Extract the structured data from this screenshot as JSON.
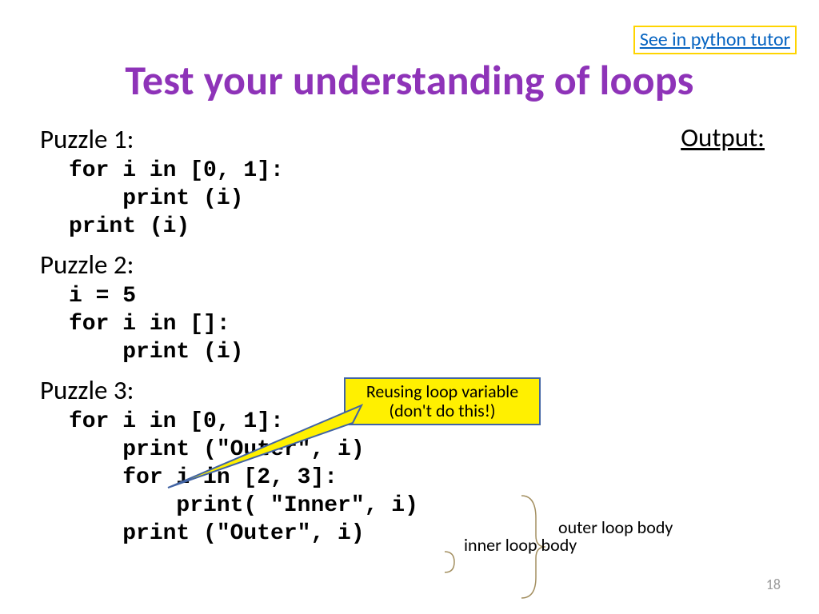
{
  "link": {
    "label": "See in python tutor"
  },
  "title": "Test your understanding of loops",
  "output_label": "Output:",
  "puzzles": {
    "p1": {
      "heading": "Puzzle 1:",
      "code": "for i in [0, 1]:\n    print (i)\nprint (i)"
    },
    "p2": {
      "heading": "Puzzle 2:",
      "code": "i = 5\nfor i in []:\n    print (i)"
    },
    "p3": {
      "heading": "Puzzle 3:",
      "code": "for i in [0, 1]:\n    print (\"Outer\", i)\n    for i in [2, 3]:\n        print( \"Inner\", i)\n    print (\"Outer\", i)"
    }
  },
  "callout": "Reusing loop variable\n(don't do this!)",
  "labels": {
    "inner": "inner\nloop\nbody",
    "outer": "outer\nloop\nbody"
  },
  "page_number": "18"
}
